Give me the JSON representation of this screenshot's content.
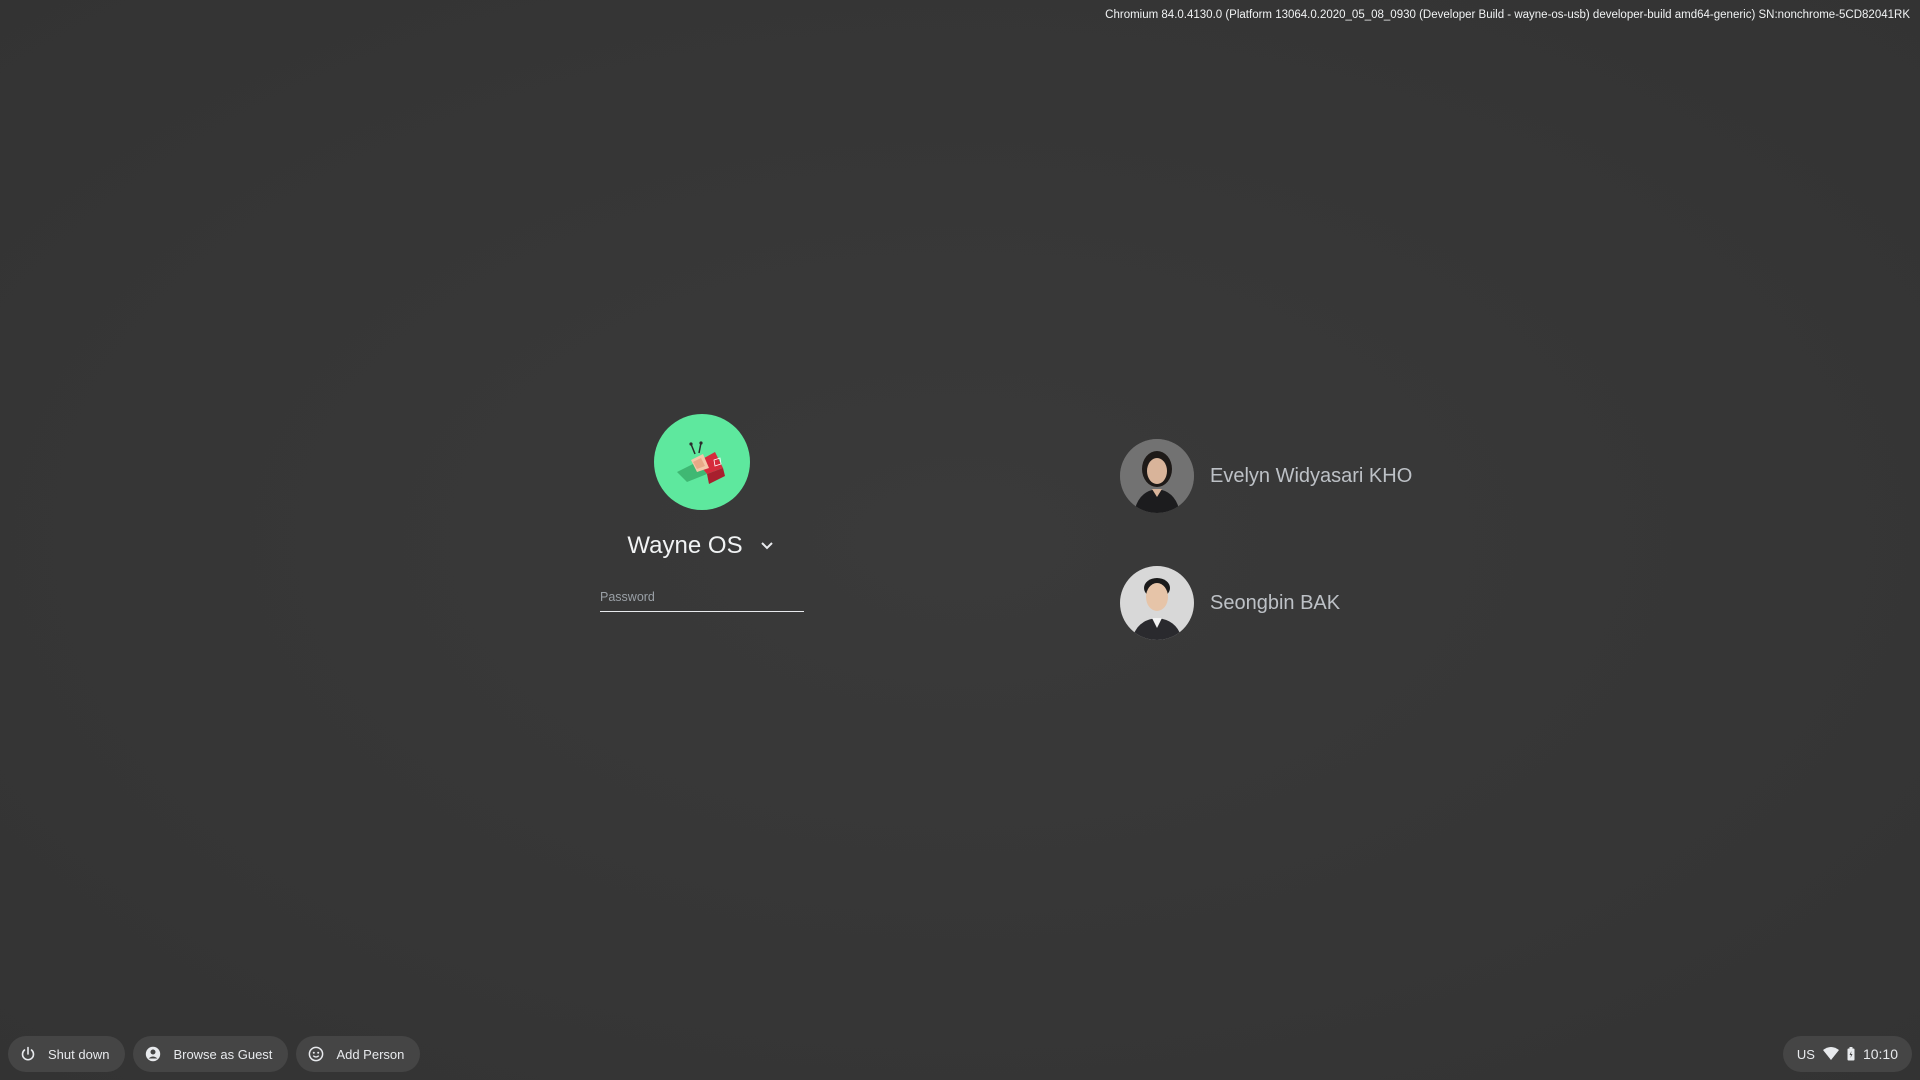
{
  "system": {
    "version_info": "Chromium 84.0.4130.0 (Platform 13064.0.2020_05_08_0930 (Developer Build - wayne-os-usb) developer-build amd64-generic) SN:nonchrome-5CD82041RK"
  },
  "primary_user": {
    "name": "Wayne OS",
    "avatar_icon": "book-snail-icon",
    "avatar_color": "#5ee89e",
    "password_placeholder": "Password"
  },
  "other_users": [
    {
      "name": "Evelyn Widyasari KHO",
      "avatar": "person-photo"
    },
    {
      "name": "Seongbin BAK",
      "avatar": "person-photo"
    }
  ],
  "shelf": {
    "shutdown_label": "Shut down",
    "guest_label": "Browse as Guest",
    "add_person_label": "Add Person"
  },
  "status": {
    "keyboard_layout": "US",
    "time": "10:10"
  }
}
